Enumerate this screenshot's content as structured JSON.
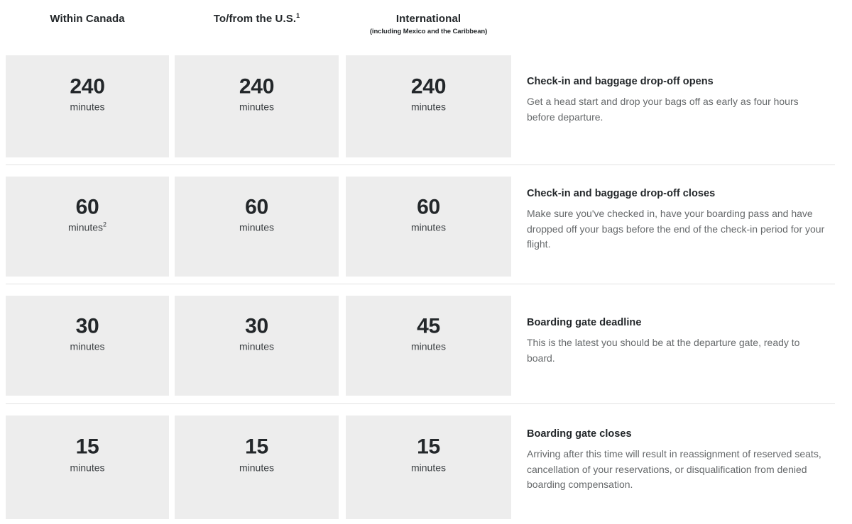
{
  "table": {
    "columns": [
      {
        "title": "Within Canada",
        "footnote": "",
        "subtitle": ""
      },
      {
        "title": "To/from the U.S.",
        "footnote": "1",
        "subtitle": ""
      },
      {
        "title": "International",
        "footnote": "",
        "subtitle": "(including Mexico and the Caribbean)"
      }
    ],
    "rows": [
      {
        "title": "Check-in and baggage drop-off opens",
        "description": "Get a head start and drop your bags off as early as four hours before departure.",
        "cells": [
          {
            "value": "240",
            "unit": "minutes",
            "footnote": ""
          },
          {
            "value": "240",
            "unit": "minutes",
            "footnote": ""
          },
          {
            "value": "240",
            "unit": "minutes",
            "footnote": ""
          }
        ]
      },
      {
        "title": "Check-in and baggage drop-off closes",
        "description": "Make sure you've checked in, have your boarding pass and have dropped off your bags before the end of the check-in period for your flight.",
        "cells": [
          {
            "value": "60",
            "unit": "minutes",
            "footnote": "2"
          },
          {
            "value": "60",
            "unit": "minutes",
            "footnote": ""
          },
          {
            "value": "60",
            "unit": "minutes",
            "footnote": ""
          }
        ]
      },
      {
        "title": "Boarding gate deadline",
        "description": "This is the latest you should be at the departure gate, ready to board.",
        "cells": [
          {
            "value": "30",
            "unit": "minutes",
            "footnote": ""
          },
          {
            "value": "30",
            "unit": "minutes",
            "footnote": ""
          },
          {
            "value": "45",
            "unit": "minutes",
            "footnote": ""
          }
        ]
      },
      {
        "title": "Boarding gate closes",
        "description": "Arriving after this time will result in reassignment of reserved seats, cancellation of your reservations, or disqualification from denied boarding compensation.",
        "cells": [
          {
            "value": "15",
            "unit": "minutes",
            "footnote": ""
          },
          {
            "value": "15",
            "unit": "minutes",
            "footnote": ""
          },
          {
            "value": "15",
            "unit": "minutes",
            "footnote": ""
          }
        ]
      }
    ],
    "colors": {
      "cell_background": "#ededed",
      "heading_text": "#23272a",
      "body_text": "#66696b",
      "divider": "#e3e3e3",
      "page_background": "#ffffff"
    }
  }
}
